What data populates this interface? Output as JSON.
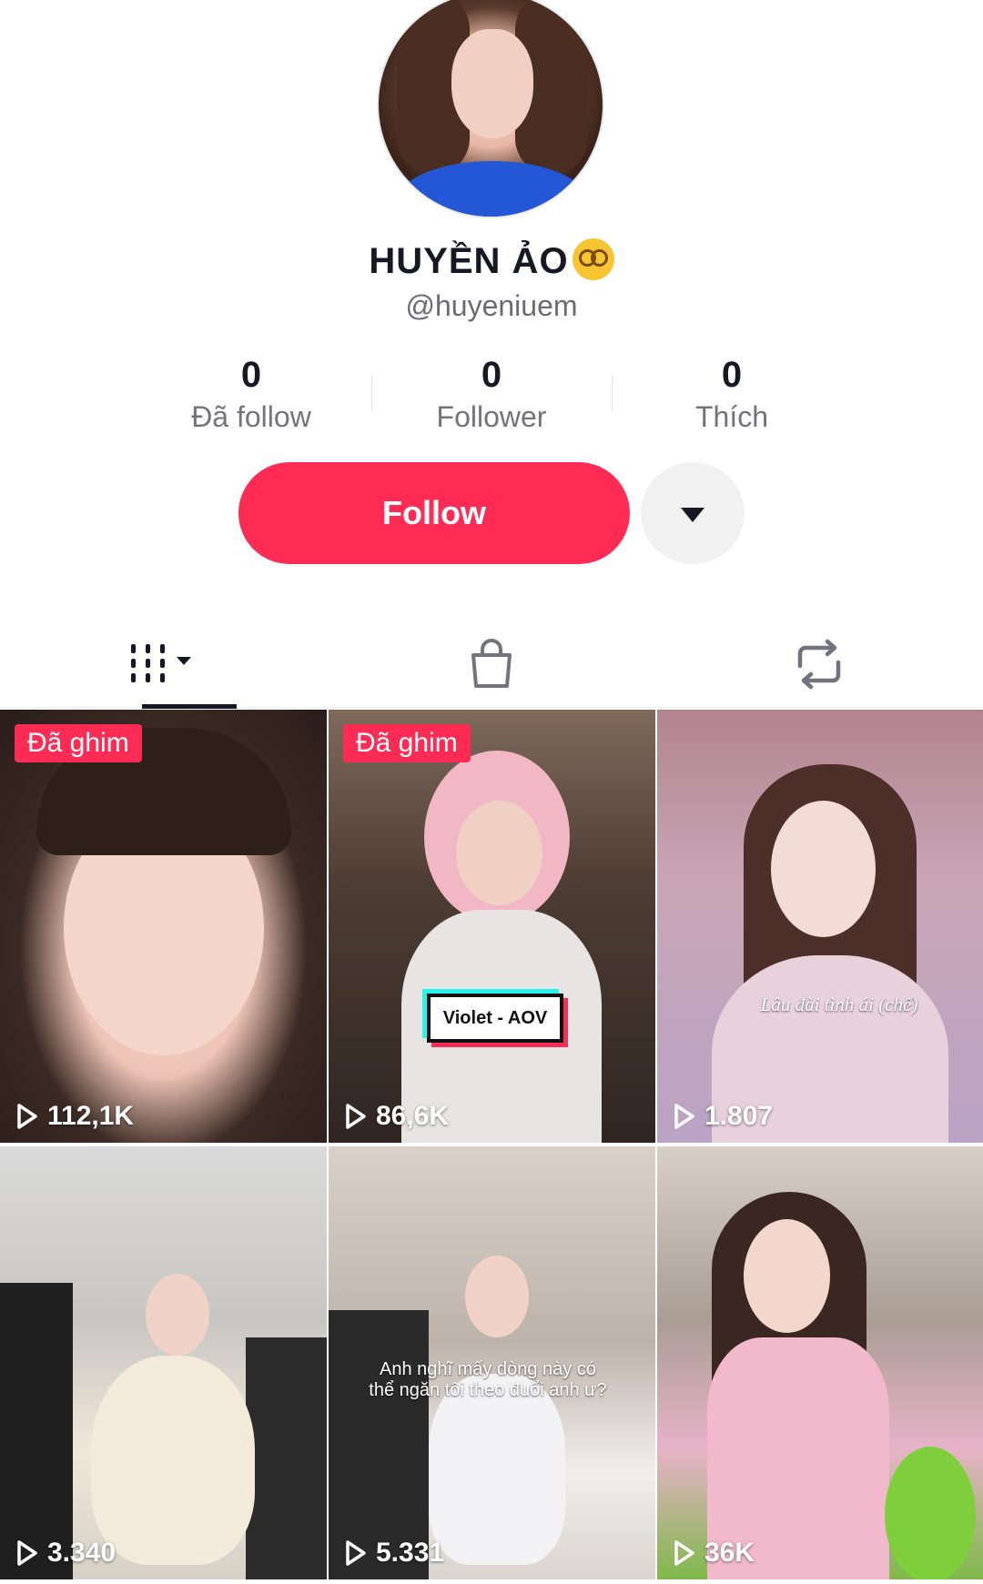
{
  "profile": {
    "display_name": "HUYỀN ẢO",
    "handle": "@huyeniuem",
    "stats": [
      {
        "value": "0",
        "label": "Đã follow"
      },
      {
        "value": "0",
        "label": "Follower"
      },
      {
        "value": "0",
        "label": "Thích"
      }
    ],
    "follow_label": "Follow"
  },
  "tabs": [
    {
      "icon": "grid-videos-icon",
      "active": true
    },
    {
      "icon": "shopping-bag-icon",
      "active": false
    },
    {
      "icon": "repost-icon",
      "active": false
    }
  ],
  "videos": [
    {
      "pinned_label": "Đã ghim",
      "views": "112,1K"
    },
    {
      "pinned_label": "Đã ghim",
      "views": "86,6K",
      "overlay_text": "Violet - AOV"
    },
    {
      "views": "1.807",
      "overlay_text": "Lâu đài tình ái (chế)"
    },
    {
      "views": "3.340"
    },
    {
      "views": "5.331",
      "overlay_text": "Anh nghĩ mấy dòng này có thể ngăn tôi theo đuổi anh ư?"
    },
    {
      "views": "36K"
    }
  ],
  "colors": {
    "accent": "#fe2c55",
    "text": "#161823",
    "muted": "#73737d"
  }
}
